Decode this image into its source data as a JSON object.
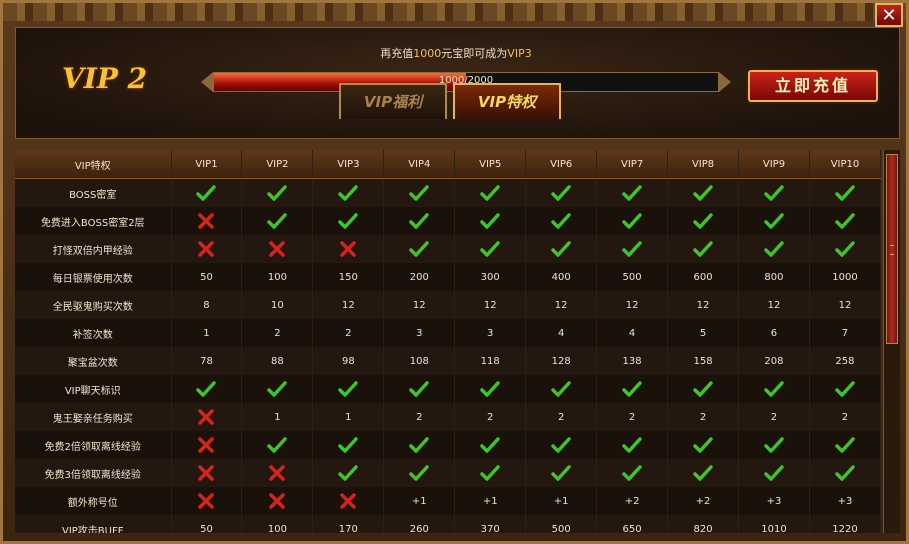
{
  "window": {
    "close_label": "✕"
  },
  "header": {
    "vip_level": "VIP 2",
    "hint_prefix": "再充值",
    "hint_amount": "1000",
    "hint_middle": "元宝即可成为",
    "hint_target": "VIP3",
    "progress_text": "1000/2000",
    "progress_fraction": 0.5,
    "recharge_label": "立即充值"
  },
  "tabs": [
    {
      "label": "VIP福利",
      "active": false
    },
    {
      "label": "VIP特权",
      "active": true
    }
  ],
  "table": {
    "columns": [
      "VIP特权",
      "VIP1",
      "VIP2",
      "VIP3",
      "VIP4",
      "VIP5",
      "VIP6",
      "VIP7",
      "VIP8",
      "VIP9",
      "VIP10"
    ],
    "rows": [
      {
        "name": "BOSS密室",
        "cells": [
          "check",
          "check",
          "check",
          "check",
          "check",
          "check",
          "check",
          "check",
          "check",
          "check"
        ]
      },
      {
        "name": "免费进入BOSS密室2层",
        "cells": [
          "cross",
          "check",
          "check",
          "check",
          "check",
          "check",
          "check",
          "check",
          "check",
          "check"
        ]
      },
      {
        "name": "打怪双倍内甲经验",
        "cells": [
          "cross",
          "cross",
          "cross",
          "check",
          "check",
          "check",
          "check",
          "check",
          "check",
          "check"
        ]
      },
      {
        "name": "每日银票使用次数",
        "cells": [
          "50",
          "100",
          "150",
          "200",
          "300",
          "400",
          "500",
          "600",
          "800",
          "1000"
        ]
      },
      {
        "name": "全民驱鬼购买次数",
        "cells": [
          "8",
          "10",
          "12",
          "12",
          "12",
          "12",
          "12",
          "12",
          "12",
          "12"
        ]
      },
      {
        "name": "补签次数",
        "cells": [
          "1",
          "2",
          "2",
          "3",
          "3",
          "4",
          "4",
          "5",
          "6",
          "7"
        ]
      },
      {
        "name": "聚宝盆次数",
        "cells": [
          "78",
          "88",
          "98",
          "108",
          "118",
          "128",
          "138",
          "158",
          "208",
          "258"
        ]
      },
      {
        "name": "VIP聊天标识",
        "cells": [
          "check",
          "check",
          "check",
          "check",
          "check",
          "check",
          "check",
          "check",
          "check",
          "check"
        ]
      },
      {
        "name": "鬼王娶亲任务购买",
        "cells": [
          "cross",
          "1",
          "1",
          "2",
          "2",
          "2",
          "2",
          "2",
          "2",
          "2"
        ]
      },
      {
        "name": "免费2倍领取离线经验",
        "cells": [
          "cross",
          "check",
          "check",
          "check",
          "check",
          "check",
          "check",
          "check",
          "check",
          "check"
        ]
      },
      {
        "name": "免费3倍领取离线经验",
        "cells": [
          "cross",
          "cross",
          "check",
          "check",
          "check",
          "check",
          "check",
          "check",
          "check",
          "check"
        ]
      },
      {
        "name": "额外称号位",
        "cells": [
          "cross",
          "cross",
          "cross",
          "+1",
          "+1",
          "+1",
          "+2",
          "+2",
          "+3",
          "+3"
        ]
      },
      {
        "name": "VIP攻击BUFF",
        "cells": [
          "50",
          "100",
          "170",
          "260",
          "370",
          "500",
          "650",
          "820",
          "1010",
          "1220"
        ]
      }
    ]
  },
  "icons": {
    "check": "check-icon",
    "cross": "cross-icon"
  },
  "colors": {
    "check": "#3fc42a",
    "cross": "#d8231b",
    "gold": "#f6c23a",
    "accent_red": "#c9221a"
  }
}
